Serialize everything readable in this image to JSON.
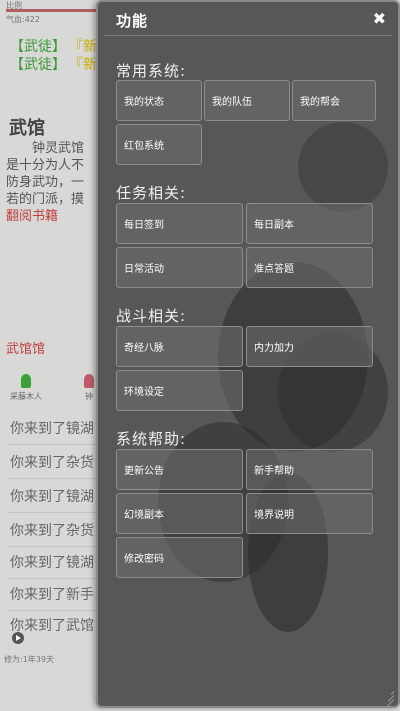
{
  "background": {
    "status_line1": "比例",
    "status_line2": "气血:422",
    "chat": [
      {
        "rank": "【武徒】",
        "name": "『新"
      },
      {
        "rank": "【武徒】",
        "name": "『新"
      }
    ],
    "location_title": "武馆",
    "location_desc_1": "钟灵武馆",
    "location_desc_2": "是十分为人不",
    "location_desc_3": "防身武功，一",
    "location_desc_4": "若的门派，摸",
    "location_desc_5": "翻阅书籍",
    "red_link": "武馆馆",
    "npcs": [
      {
        "label": "采藤木人",
        "color": "#3aa03a"
      },
      {
        "label": "钟",
        "color": "#c05a6a"
      }
    ],
    "log": [
      "你来到了镜湖",
      "你来到了杂货",
      "你来到了镜湖",
      "你来到了杂货",
      "你来到了镜湖",
      "你来到了新手",
      "你来到了武馆"
    ],
    "bottom_line": "修为:1年39天"
  },
  "panel": {
    "title": "功能",
    "close_label": "✖",
    "sections": [
      {
        "title": "常用系统:",
        "buttons": [
          "我的状态",
          "我的队伍",
          "我的帮会",
          "红包系统"
        ]
      },
      {
        "title": "任务相关:",
        "buttons": [
          "每日签到",
          "每日副本",
          "日常活动",
          "准点答题"
        ]
      },
      {
        "title": "战斗相关:",
        "buttons": [
          "奇经八脉",
          "内力加力",
          "环境设定"
        ]
      },
      {
        "title": "系统帮助:",
        "buttons": [
          "更新公告",
          "新手帮助",
          "幻境副本",
          "境界说明",
          "修改密码"
        ]
      }
    ]
  }
}
